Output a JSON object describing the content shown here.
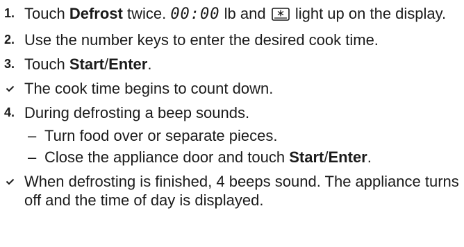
{
  "steps": [
    {
      "num": "1.",
      "text_a": "Touch ",
      "bold_a": "Defrost",
      "text_b": " twice. ",
      "display_value": "00:00",
      "text_c": " lb and ",
      "text_d": " light up on the display."
    },
    {
      "num": "2.",
      "text": "Use the number keys to enter the desired cook time."
    },
    {
      "num": "3.",
      "text_a": "Touch ",
      "bold_start": "Start",
      "slash": "/",
      "bold_enter": "Enter",
      "text_b": "."
    }
  ],
  "result_1": "The cook time begins to count down.",
  "step_4": {
    "num": "4.",
    "text": "During defrosting a beep sounds.",
    "sub_items": [
      {
        "dash": "–",
        "text": "Turn food over or separate pieces."
      },
      {
        "dash": "–",
        "text_a": "Close the appliance door and touch ",
        "bold_start": "Start",
        "slash": "/",
        "bold_enter": "Enter",
        "text_b": "."
      }
    ]
  },
  "result_2": "When defrosting is finished, 4 beeps sound. The appliance turns off and the time of day is displayed.",
  "icons": {
    "check": "check-icon",
    "defrost": "defrost-snowflake-icon"
  }
}
